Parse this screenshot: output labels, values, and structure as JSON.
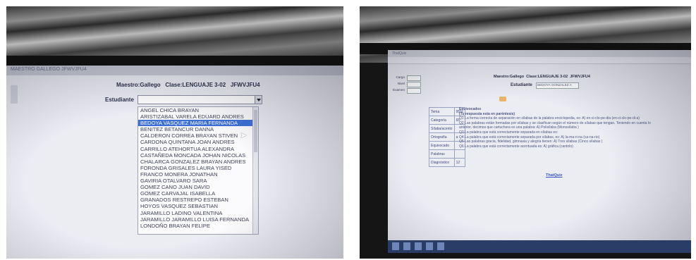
{
  "left": {
    "window_title": "MAESTRO GALLEGO JFWVJFU4",
    "maestro_label": "Maestro:Gallego",
    "clase_label": "Clase:LENGUAJE 3-02",
    "clase_code": "JFWVJFU4",
    "estudiante_label": "Estudiante",
    "dropdown_options": [
      "ANGEL CHICA  BRAYAN",
      "ARISTIZABAL VARELA  EDUARD ANDRES",
      "BEDOYA VASQUEZ  MARIA FERNANDA",
      "BENITEZ BETANCUR  DANNA",
      "CALDERON CORREA  BRAYAN STIVEN",
      "CARDONA QUINTANA  JOAN ANDRES",
      "CARRILLO ATEHORTUA  ALEXANDRA",
      "CASTAÑEDA MONCADA  JOHAN NICOLAS",
      "CHALARCA GONZALEZ  BRAYAN ANDRES",
      "FORONDA GRISALES  LAURA YISED",
      "FRANCO MONERA  JONATHAN",
      "GAVIRIA OTALVARO  SARA",
      "GOMEZ CANO  JUAN DAVID",
      "GOMEZ CARVAJAL  ISABELLA",
      "GRANADOS RESTREPO  ESTEBAN",
      "HOYOS VASQUEZ  SEBASTIAN",
      "JARAMILLO LADINO  VALENTINA",
      "JARAMILLO JARAMILLO  LUISA FERNANDA",
      "LONDOÑO  BRAYAN FELIPE"
    ],
    "selected_index": 2
  },
  "right": {
    "tab_title": "ThatQuiz",
    "maestro_label": "Maestro:Gallego",
    "clase_label": "Clase:LENGUAJE 3-02",
    "clase_code": "JFWVJFU4",
    "estudiante_label": "Estudiante",
    "estudiante_value": "BEDOYA GONZALEZ A",
    "left_fields": [
      {
        "label": "Cargo"
      },
      {
        "label": "Nivel"
      },
      {
        "label": "Examen"
      }
    ],
    "table_header": [
      "Tema",
      "95%"
    ],
    "table_rows": [
      {
        "tema": "Categoría",
        "val": "65"
      },
      {
        "tema": "Sílaba/acento",
        "val": ""
      },
      {
        "tema": "Ortografía",
        "val": "a"
      },
      {
        "tema": "Equivocado",
        "val": ""
      },
      {
        "tema": "Palabras",
        "val": ""
      },
      {
        "tema": "Diagnóstico",
        "val": "12"
      }
    ],
    "section_title": "Equivocados",
    "section_subtitle": "(Tu respuesta esta en paréntesis)",
    "lines": [
      "Q1 La forma correcta de separación en sílabas de la palabra enciclopedia, es: A) en-ci-clo-pe-dia (en-ci-clo-pe-di-a)",
      "Q2 Las palabras están formadas por sílabas y se clasifican según el número de sílabas que tengan. Teniendo en cuenta lo",
      "anterior, decimos que cartuchera es una palabra: A) Polisílaba  (Monosílaba )",
      "Q3 La palabra que está correctamente separada en sílabas es:",
      "Q4 La palabra que está correctamente separada por sílabas, es: A) la-ma-ri-na (ca-na-rio)",
      "Q5 Las palabras gracia, fidelidad, gimnasia y alegría tienen: A) Tres sílabas  (Cinco sílabas )",
      "Q6 La palabra que está correctamente acentuada es: A) gráfica (cantolo)"
    ],
    "footer_link": "ThatQuiz"
  }
}
